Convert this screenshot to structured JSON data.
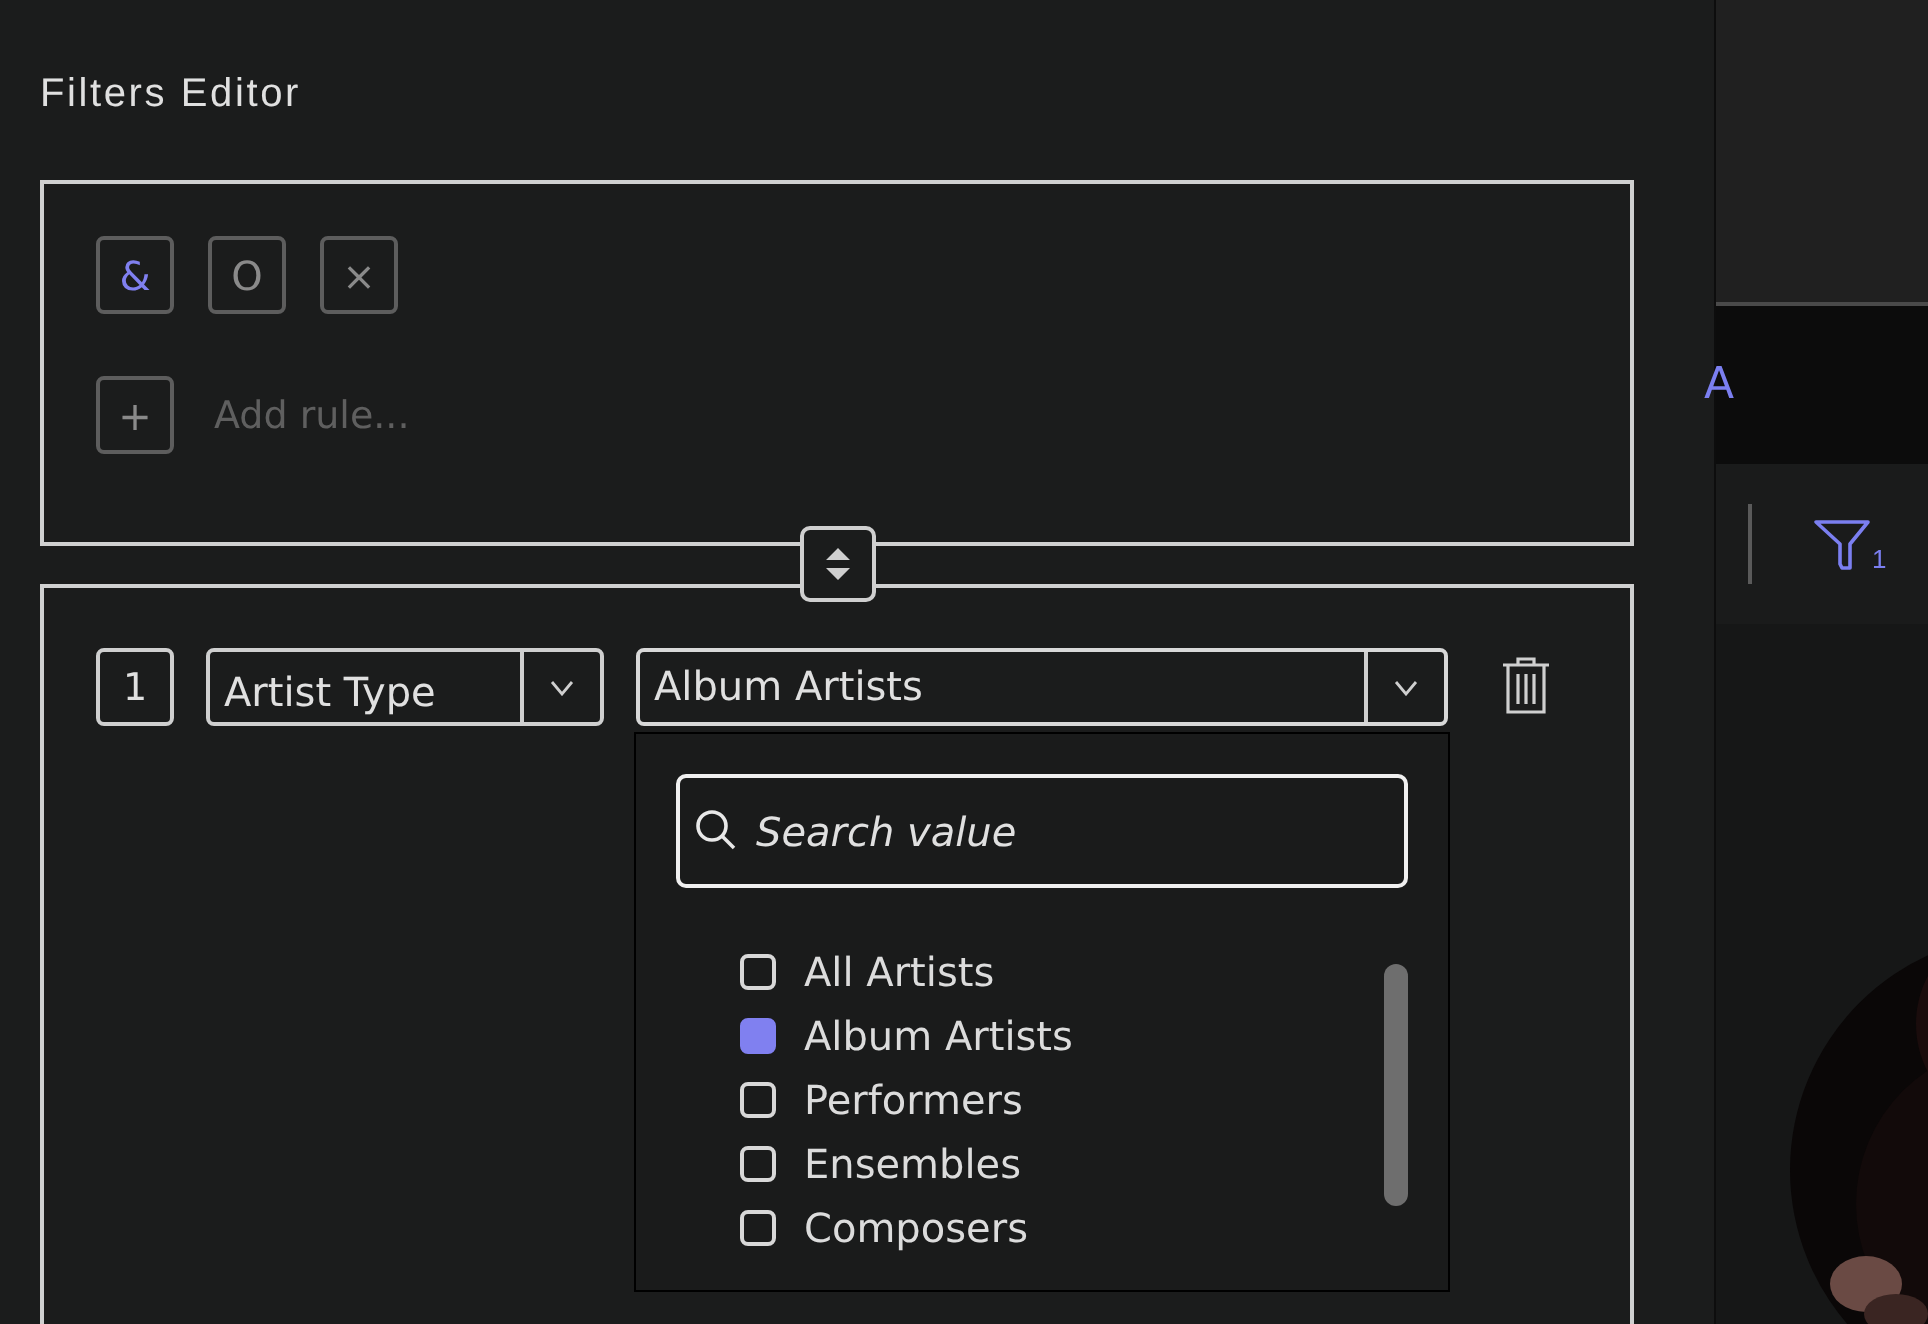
{
  "title": "Filters Editor",
  "operators": [
    {
      "symbol": "&",
      "selected": true
    },
    {
      "symbol": "O",
      "selected": false
    },
    {
      "symbol": "×",
      "selected": false
    }
  ],
  "add_rule": {
    "icon": "+",
    "label": "Add rule..."
  },
  "rules": [
    {
      "index": "1",
      "field": "Artist Type",
      "value": "Album Artists",
      "expanded": true,
      "dropdown": {
        "placeholder": "Search value",
        "options": [
          {
            "label": "All Artists",
            "checked": false
          },
          {
            "label": "Album Artists",
            "checked": true
          },
          {
            "label": "Performers",
            "checked": false
          },
          {
            "label": "Ensembles",
            "checked": false
          },
          {
            "label": "Composers",
            "checked": false
          }
        ]
      }
    }
  ],
  "side": {
    "tab_letter": "A",
    "filter_count": "1"
  }
}
